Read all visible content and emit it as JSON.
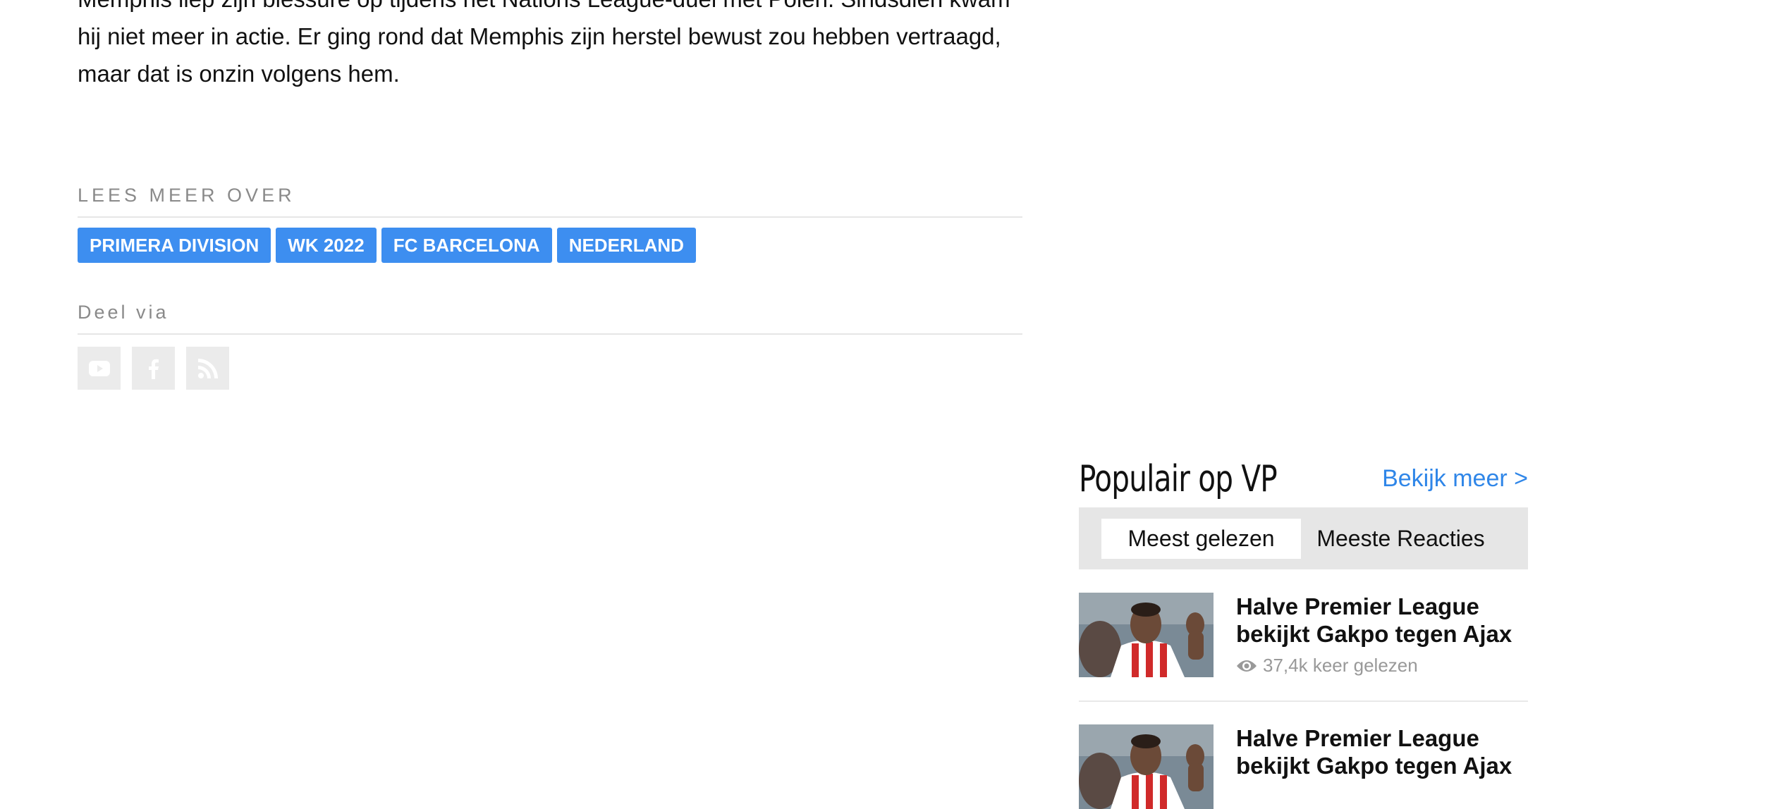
{
  "article": {
    "paragraph": "Memphis liep zijn blessure op tijdens het Nations League-duel met Polen. Sindsdien kwam hij niet meer in actie. Er ging rond dat Memphis zijn herstel bewust zou hebben vertraagd, maar dat is onzin volgens hem."
  },
  "tags": {
    "heading": "LEES MEER OVER",
    "items": [
      "PRIMERA DIVISION",
      "WK 2022",
      "FC BARCELONA",
      "NEDERLAND"
    ],
    "color": "#3d8ef0"
  },
  "share": {
    "heading": "Deel via",
    "icons": [
      "youtube-icon",
      "facebook-icon",
      "rss-icon"
    ]
  },
  "popular": {
    "title": "Populair op VP",
    "more_link": "Bekijk meer >",
    "tabs": [
      "Meest gelezen",
      "Meeste Reacties"
    ],
    "active_tab": "Meest gelezen",
    "accent": "#2f86e8",
    "items": [
      {
        "title": "Halve Premier League bekijkt Gakpo tegen Ajax",
        "views": "37,4k keer gelezen"
      },
      {
        "title": "Halve Premier League bekijkt Gakpo tegen Ajax"
      }
    ]
  }
}
